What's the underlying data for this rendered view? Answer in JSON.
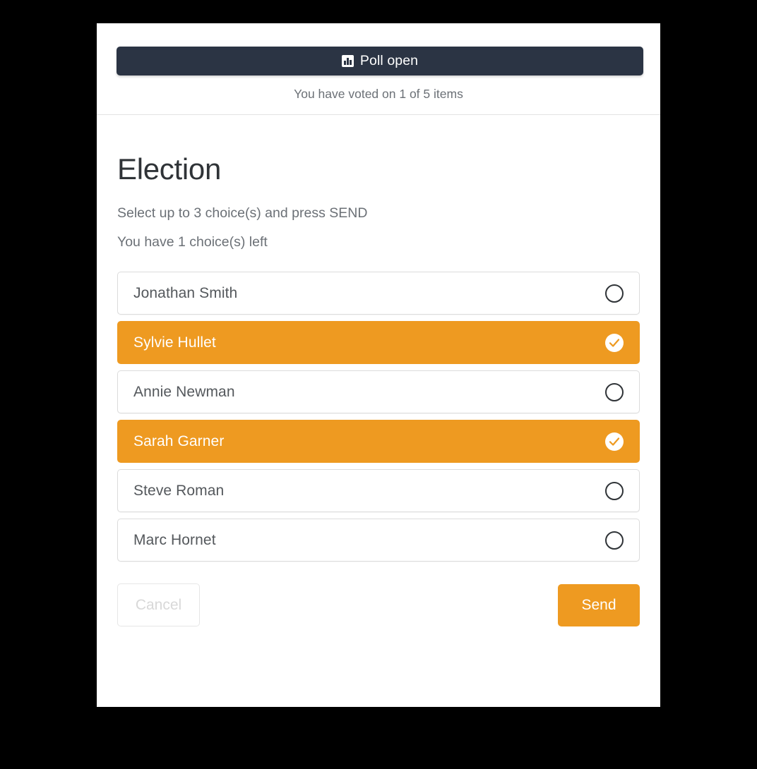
{
  "header": {
    "status_icon": "bar-chart-icon",
    "status_label": "Poll open",
    "voted_summary": "You have voted on 1 of 5 items"
  },
  "poll": {
    "title": "Election",
    "instruction": "Select up to 3 choice(s) and press SEND",
    "remaining": "You have 1 choice(s) left",
    "max_choices": 3,
    "choices_left": 1,
    "options": [
      {
        "label": "Jonathan Smith",
        "selected": false,
        "marker": "radio-empty-icon"
      },
      {
        "label": "Sylvie Hullet",
        "selected": true,
        "marker": "check-circle-icon"
      },
      {
        "label": "Annie Newman",
        "selected": false,
        "marker": "radio-empty-icon"
      },
      {
        "label": "Sarah Garner",
        "selected": true,
        "marker": "check-circle-icon"
      },
      {
        "label": "Steve Roman",
        "selected": false,
        "marker": "radio-empty-icon"
      },
      {
        "label": "Marc Hornet",
        "selected": false,
        "marker": "radio-empty-icon"
      }
    ]
  },
  "actions": {
    "cancel_label": "Cancel",
    "cancel_disabled": true,
    "send_label": "Send"
  },
  "colors": {
    "accent_orange": "#ee9a21",
    "header_dark": "#2b3444",
    "card_background": "#ffffff",
    "page_background": "#000000",
    "muted_text": "#6b7076",
    "option_border": "#dcdcdc"
  }
}
